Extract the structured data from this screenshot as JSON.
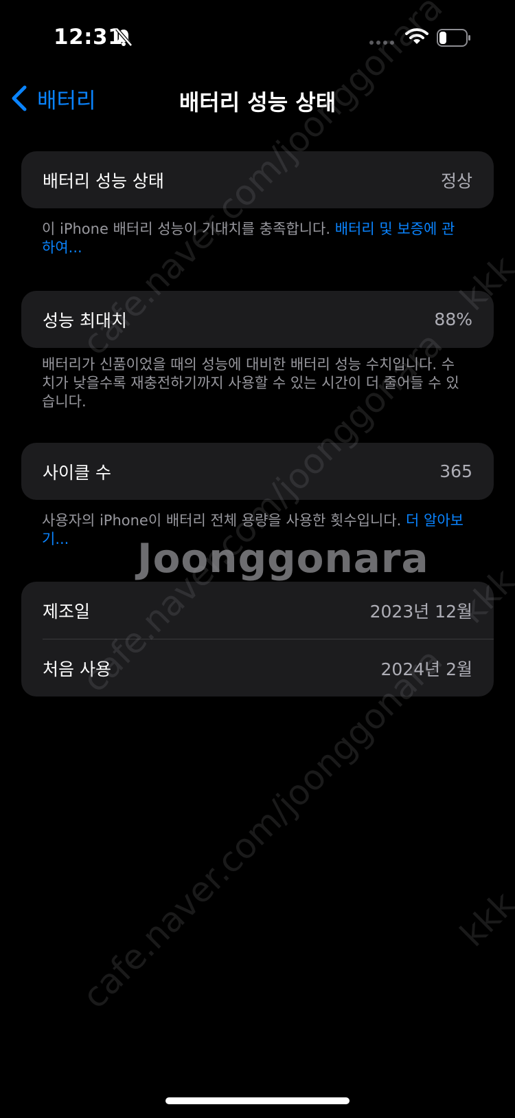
{
  "status_bar": {
    "time": "12:31"
  },
  "nav": {
    "back_label": "배터리",
    "title": "배터리 성능 상태"
  },
  "health": {
    "label": "배터리 성능 상태",
    "value": "정상",
    "footer": "이 iPhone 배터리 성능이 기대치를 충족합니다. ",
    "footer_link": "배터리 및 보증에 관하여..."
  },
  "max_capacity": {
    "label": "성능 최대치",
    "value": "88%",
    "footer": "배터리가 신품이었을 때의 성능에 대비한 배터리 성능 수치입니다. 수치가 낮을수록 재충전하기까지 사용할 수 있는 시간이 더 줄어들 수 있습니다."
  },
  "cycle_count": {
    "label": "사이클 수",
    "value": "365",
    "footer": "사용자의 iPhone이 배터리 전체 용량을 사용한 횟수입니다. ",
    "footer_link": "더 알아보기..."
  },
  "dates": {
    "manufacture_label": "제조일",
    "manufacture_value": "2023년 12월",
    "first_use_label": "처음 사용",
    "first_use_value": "2024년 2월"
  },
  "watermark": {
    "url": "cafe.naver.com/joonggonara",
    "logo": "Joonggonara",
    "side": "kkk"
  },
  "icons": {
    "bell": "bell-slash-icon",
    "signal": "cellular-signal-icon",
    "wifi": "wifi-icon",
    "battery": "battery-icon",
    "back": "chevron-left-icon"
  },
  "colors": {
    "accent": "#0a84ff",
    "card": "#1c1c1e",
    "background": "#000000"
  }
}
